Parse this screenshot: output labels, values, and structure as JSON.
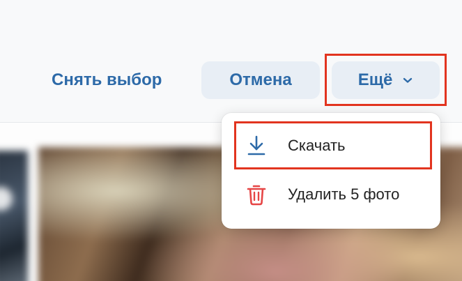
{
  "toolbar": {
    "deselect_label": "Снять выбор",
    "cancel_label": "Отмена",
    "more_label": "Ещё"
  },
  "menu": {
    "items": [
      {
        "label": "Скачать",
        "icon": "download-icon"
      },
      {
        "label": "Удалить 5 фото",
        "icon": "trash-icon"
      }
    ]
  },
  "colors": {
    "accent": "#2d6aa8",
    "secondary_button_bg": "#e8eef5",
    "highlight": "#e2341f",
    "delete_icon": "#e64646"
  }
}
